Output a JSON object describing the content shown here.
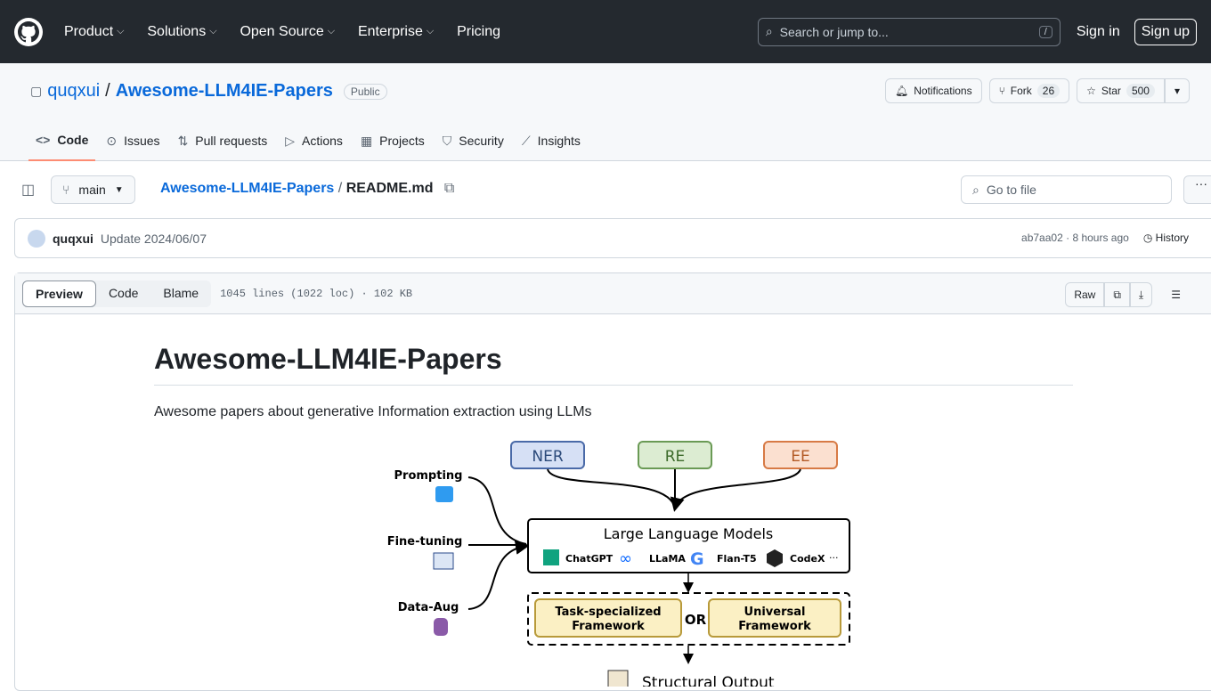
{
  "header": {
    "nav": [
      "Product",
      "Solutions",
      "Open Source",
      "Enterprise",
      "Pricing"
    ],
    "search_placeholder": "Search or jump to...",
    "slash": "/",
    "sign_in": "Sign in",
    "sign_up": "Sign up"
  },
  "repo": {
    "owner": "quqxui",
    "name": "Awesome-LLM4IE-Papers",
    "visibility": "Public",
    "notifications": "Notifications",
    "fork": "Fork",
    "fork_count": "26",
    "star": "Star",
    "star_count": "500"
  },
  "tabs": [
    {
      "label": "Code",
      "icon": "code-icon"
    },
    {
      "label": "Issues",
      "icon": "issue-icon"
    },
    {
      "label": "Pull requests",
      "icon": "pr-icon"
    },
    {
      "label": "Actions",
      "icon": "play-icon"
    },
    {
      "label": "Projects",
      "icon": "table-icon"
    },
    {
      "label": "Security",
      "icon": "shield-icon"
    },
    {
      "label": "Insights",
      "icon": "graph-icon"
    }
  ],
  "filebar": {
    "branch": "main",
    "crumb_repo": "Awesome-LLM4IE-Papers",
    "crumb_sep": "/",
    "crumb_file": "README.md",
    "go_to_file": "Go to file"
  },
  "commit": {
    "author": "quqxui",
    "message": "Update 2024/06/07",
    "sha": "ab7aa02",
    "time": "8 hours ago",
    "sep": "·",
    "history": "History"
  },
  "file": {
    "views": [
      "Preview",
      "Code",
      "Blame"
    ],
    "meta": "1045 lines (1022 loc) · 102 KB",
    "raw": "Raw"
  },
  "readme": {
    "title": "Awesome-LLM4IE-Papers",
    "description": "Awesome papers about generative Information extraction using LLMs",
    "figure": {
      "tasks": [
        "NER",
        "RE",
        "EE"
      ],
      "methods": [
        "Prompting",
        "Fine-tuning",
        "Data-Aug"
      ],
      "llm_title": "Large Language Models",
      "models": [
        "ChatGPT",
        "LLaMA",
        "Flan-T5",
        "CodeX",
        "···"
      ],
      "frameworks": [
        "Task-specialized",
        "Framework",
        "Universal",
        "Framework"
      ],
      "or": "OR",
      "output": "Structural Output"
    }
  }
}
